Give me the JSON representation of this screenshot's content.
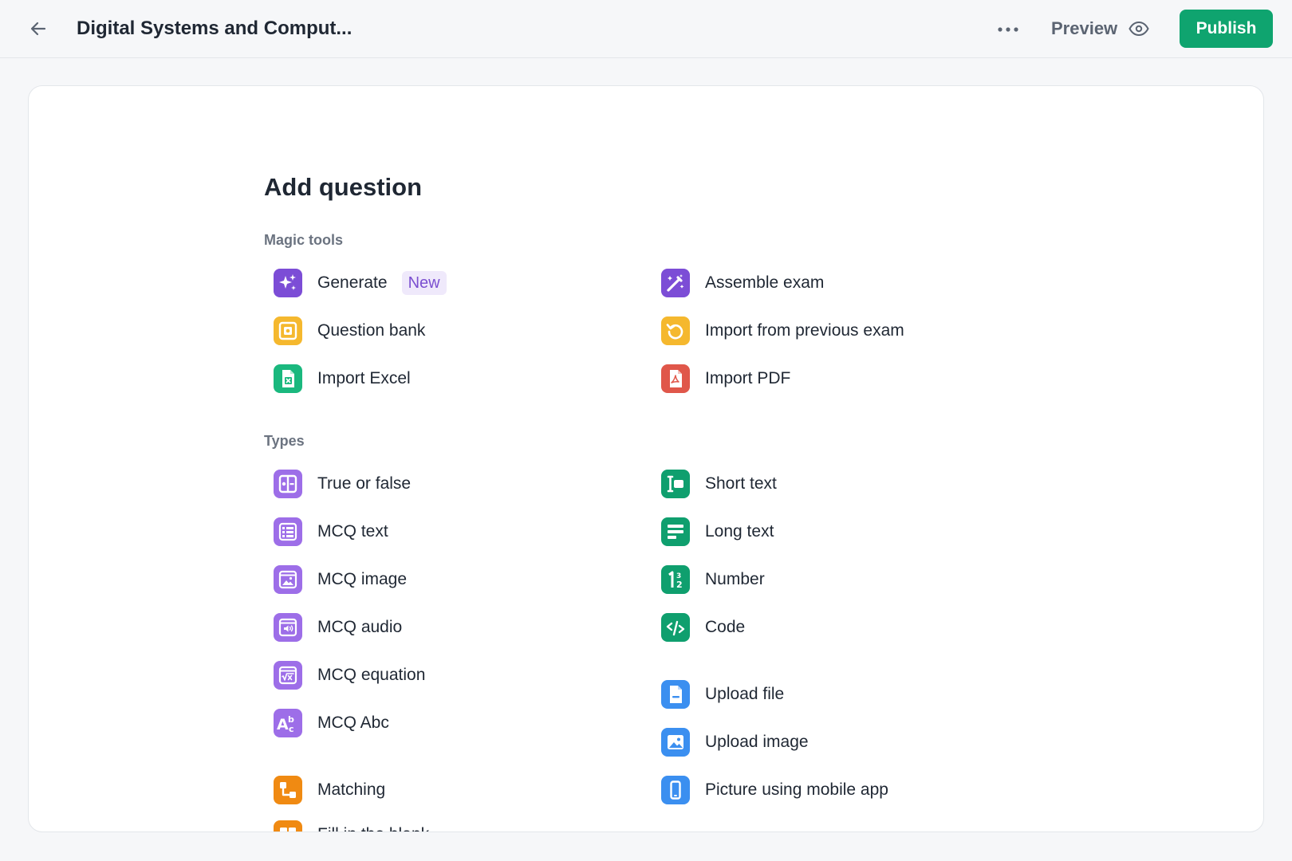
{
  "header": {
    "title": "Digital Systems and Comput...",
    "preview_label": "Preview",
    "publish_label": "Publish"
  },
  "main": {
    "heading": "Add question",
    "magic_tools": {
      "label": "Magic tools",
      "items": [
        {
          "label": "Generate",
          "badge": "New",
          "icon": "sparkles-icon"
        },
        {
          "label": "Assemble exam",
          "icon": "magic-wand-icon"
        },
        {
          "label": "Question bank",
          "icon": "vault-icon"
        },
        {
          "label": "Import from previous exam",
          "icon": "history-icon"
        },
        {
          "label": "Import Excel",
          "icon": "excel-file-icon"
        },
        {
          "label": "Import PDF",
          "icon": "pdf-file-icon"
        }
      ]
    },
    "types": {
      "label": "Types",
      "items": [
        {
          "label": "True or false",
          "icon": "toggle-icon"
        },
        {
          "label": "Short text",
          "icon": "text-cursor-icon"
        },
        {
          "label": "MCQ text",
          "icon": "list-icon"
        },
        {
          "label": "Long text",
          "icon": "paragraph-icon"
        },
        {
          "label": "MCQ image",
          "icon": "image-card-icon"
        },
        {
          "label": "Number",
          "icon": "number-icon"
        },
        {
          "label": "MCQ audio",
          "icon": "audio-card-icon"
        },
        {
          "label": "Code",
          "icon": "code-icon"
        },
        {
          "label": "MCQ equation",
          "icon": "equation-card-icon"
        },
        {
          "label": "Upload file",
          "icon": "file-upload-icon"
        },
        {
          "label": "MCQ Abc",
          "icon": "abc-icon"
        },
        {
          "label": "Upload image",
          "icon": "image-upload-icon"
        },
        {
          "label": "Matching",
          "icon": "matching-icon"
        },
        {
          "label": "Picture using mobile app",
          "icon": "mobile-phone-icon"
        },
        {
          "label": "Fill in the blank",
          "icon": "fill-blank-icon"
        }
      ]
    }
  },
  "colors": {
    "accent": "#0fa46f",
    "purple": "#8b5cf6",
    "amber": "#f5b82e",
    "orange": "#f08a12",
    "green": "#1ab87e",
    "red": "#e0574a",
    "blue": "#3b8ff0"
  }
}
